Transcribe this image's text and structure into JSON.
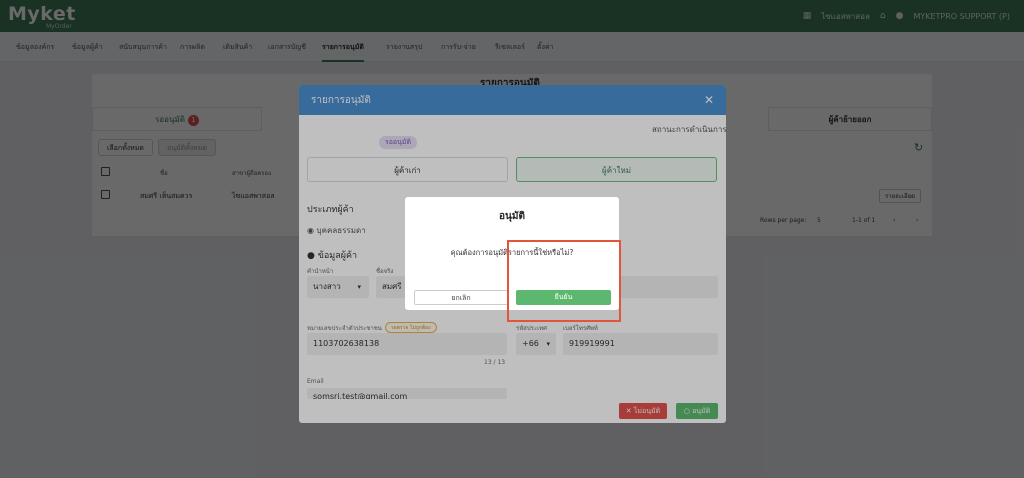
{
  "topbar": {
    "logo": "Myket",
    "logo_sub": "MyOrder",
    "branch": "ไซแอสพาสอล",
    "user": "MYKETPRO SUPPORT (P)"
  },
  "nav": {
    "items": [
      "ข้อมูลองค์กร",
      "ข้อมูลผู้ค้า",
      "สนับสนุนการค้า",
      "การผลิต",
      "เติมสินค้า",
      "เอกสารบัญชี",
      "รายการอนุมัติ",
      "รายงานสรุป",
      "การรับ-จ่าย",
      "รีเซลเลอร์",
      "ตั้งค่า"
    ],
    "active_index": 6
  },
  "page": {
    "title": "รายการอนุมัติ",
    "tab_pending": "รออนุมัติ",
    "tab_pending_count": "1",
    "tab_moved": "ผู้ค้าย้ายออก",
    "select_all": "เลือกทั้งหมด",
    "approve_all": "อนุมัติทั้งหมด",
    "col_name": "ชื่อ",
    "col_branch": "สาขาผู้ถือครอง",
    "row_name": "สมศรี เห็นสมควร",
    "row_branch": "ไซแอสพาสอล",
    "row_action": "รายละเอียด",
    "rows_per_page": "Rows per page:",
    "rows_value": "5",
    "range": "1-1 of 1"
  },
  "modal": {
    "title": "รายการอนุมัติ",
    "status_label": "สถานะการดำเนินการ",
    "status_value": "รออนุมัติ",
    "type_old": "ผู้ค้าเก่า",
    "type_new": "ผู้ค้าใหม่",
    "customer_type_title": "ประเภทผู้ค้า",
    "customer_type_value": "บุคคลธรรมดา",
    "info_title": "ข้อมูลผู้ค้า",
    "prefix_label": "คำนำหน้า",
    "prefix_value": "นางสาว",
    "firstname_label": "ชื่อจริง",
    "firstname_value": "สมศรี",
    "idcard_label": "หมายเลขประจำตัวประชาชน",
    "verify_badge": "รอตรวจ ไม่ถูกต้อง",
    "idcard_value": "1103702638138",
    "idcard_count": "13 / 13",
    "country_label": "รหัสประเทศ",
    "country_value": "+66",
    "phone_label": "เบอร์โทรศัพท์",
    "phone_value": "919919991",
    "email_label": "Email",
    "email_value": "somsri.test@gmail.com",
    "reject": "ไม่อนุมัติ",
    "approve": "อนุมัติ"
  },
  "confirm": {
    "title": "อนุมัติ",
    "message": "คุณต้องการอนุมัติรายการนี้ใช่หรือไม่?",
    "cancel": "ยกเลิก",
    "ok": "ยืนยัน"
  },
  "colors": {
    "brand": "#3e7b57",
    "modal_header": "#4a8fd0",
    "approve": "#5cb86e",
    "reject": "#e0504d",
    "highlight": "#e2553c"
  }
}
